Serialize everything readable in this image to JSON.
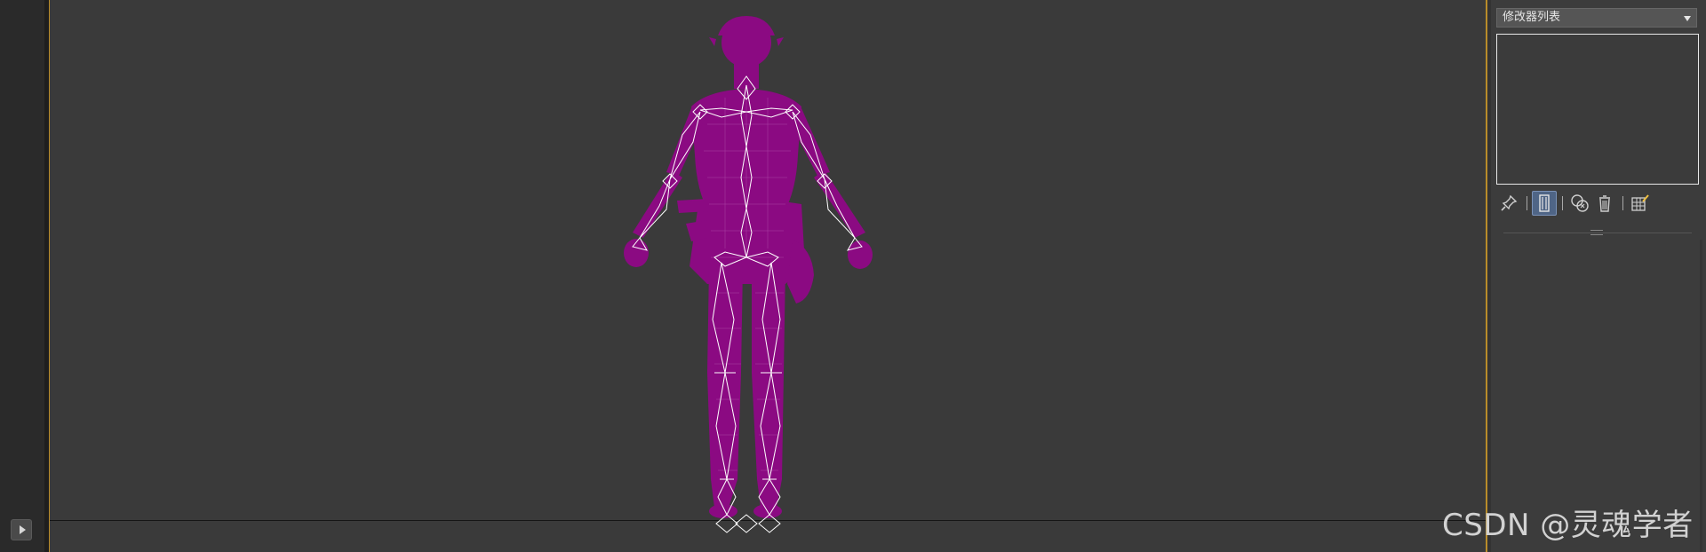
{
  "left_strip": {
    "play_button_icon": "play-triangle-icon"
  },
  "viewport": {
    "figure_color": "#8b0a82",
    "bone_color": "#ffffff",
    "background": "#3a3a3a",
    "border_accent": "#b98c2a"
  },
  "command_panel": {
    "modifier_list_label": "修改器列表",
    "toolbar_icons": [
      "pin-stack-icon",
      "show-end-result-icon",
      "make-unique-icon",
      "remove-modifier-icon",
      "configure-modifier-sets-icon"
    ]
  },
  "watermark": {
    "text": "CSDN @灵魂学者"
  }
}
